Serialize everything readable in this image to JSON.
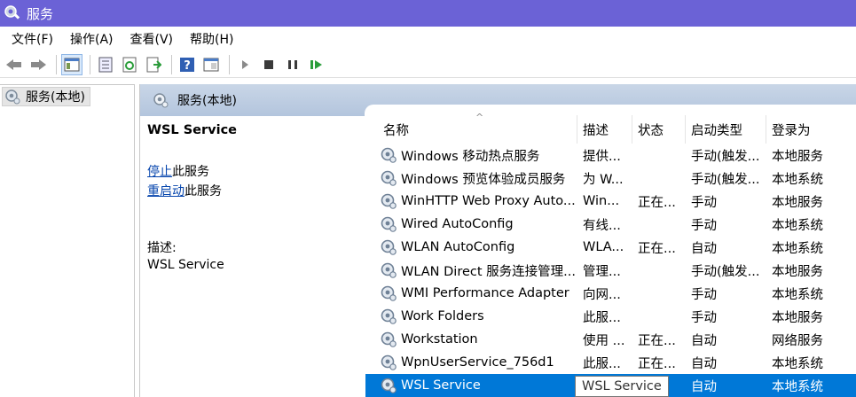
{
  "window": {
    "title": "服务"
  },
  "menu": {
    "items": [
      "文件(F)",
      "操作(A)",
      "查看(V)",
      "帮助(H)"
    ]
  },
  "toolbar": {
    "buttons": [
      "back-icon",
      "forward-icon",
      "console-tree-icon",
      "properties-icon",
      "refresh-icon",
      "export-list-icon",
      "help-icon",
      "view-icon",
      "start-icon",
      "stop-icon",
      "pause-icon",
      "resume-icon"
    ]
  },
  "tree": {
    "root_label": "服务(本地)"
  },
  "panel": {
    "header_label": "服务(本地)"
  },
  "detail": {
    "service_name": "WSL Service",
    "stop_link": "停止",
    "stop_suffix": "此服务",
    "restart_link": "重启动",
    "restart_suffix": "此服务",
    "desc_label": "描述:",
    "desc_value": "WSL Service"
  },
  "table": {
    "columns": [
      "名称",
      "描述",
      "状态",
      "启动类型",
      "登录为"
    ],
    "rows": [
      [
        "Windows 移动热点服务",
        "提供...",
        "",
        "手动(触发...",
        "本地服务"
      ],
      [
        "Windows 预览体验成员服务",
        "为 W...",
        "",
        "手动(触发...",
        "本地系统"
      ],
      [
        "WinHTTP Web Proxy Auto...",
        "Win...",
        "正在...",
        "手动",
        "本地服务"
      ],
      [
        "Wired AutoConfig",
        "有线...",
        "",
        "手动",
        "本地系统"
      ],
      [
        "WLAN AutoConfig",
        "WLA...",
        "正在...",
        "自动",
        "本地系统"
      ],
      [
        "WLAN Direct 服务连接管理...",
        "管理...",
        "",
        "手动(触发...",
        "本地服务"
      ],
      [
        "WMI Performance Adapter",
        "向网...",
        "",
        "手动",
        "本地系统"
      ],
      [
        "Work Folders",
        "此服...",
        "",
        "手动",
        "本地服务"
      ],
      [
        "Workstation",
        "使用 ...",
        "正在...",
        "自动",
        "网络服务"
      ],
      [
        "WpnUserService_756d1",
        "此服...",
        "正在...",
        "自动",
        "本地系统"
      ],
      [
        "WSL Service",
        "",
        "...",
        "自动",
        "本地系统"
      ]
    ],
    "selected_index": 10
  },
  "tooltip": {
    "text": "WSL Service"
  },
  "colors": {
    "titlebar": "#6b62d6",
    "selection": "#0078d7",
    "link": "#0645ad"
  }
}
